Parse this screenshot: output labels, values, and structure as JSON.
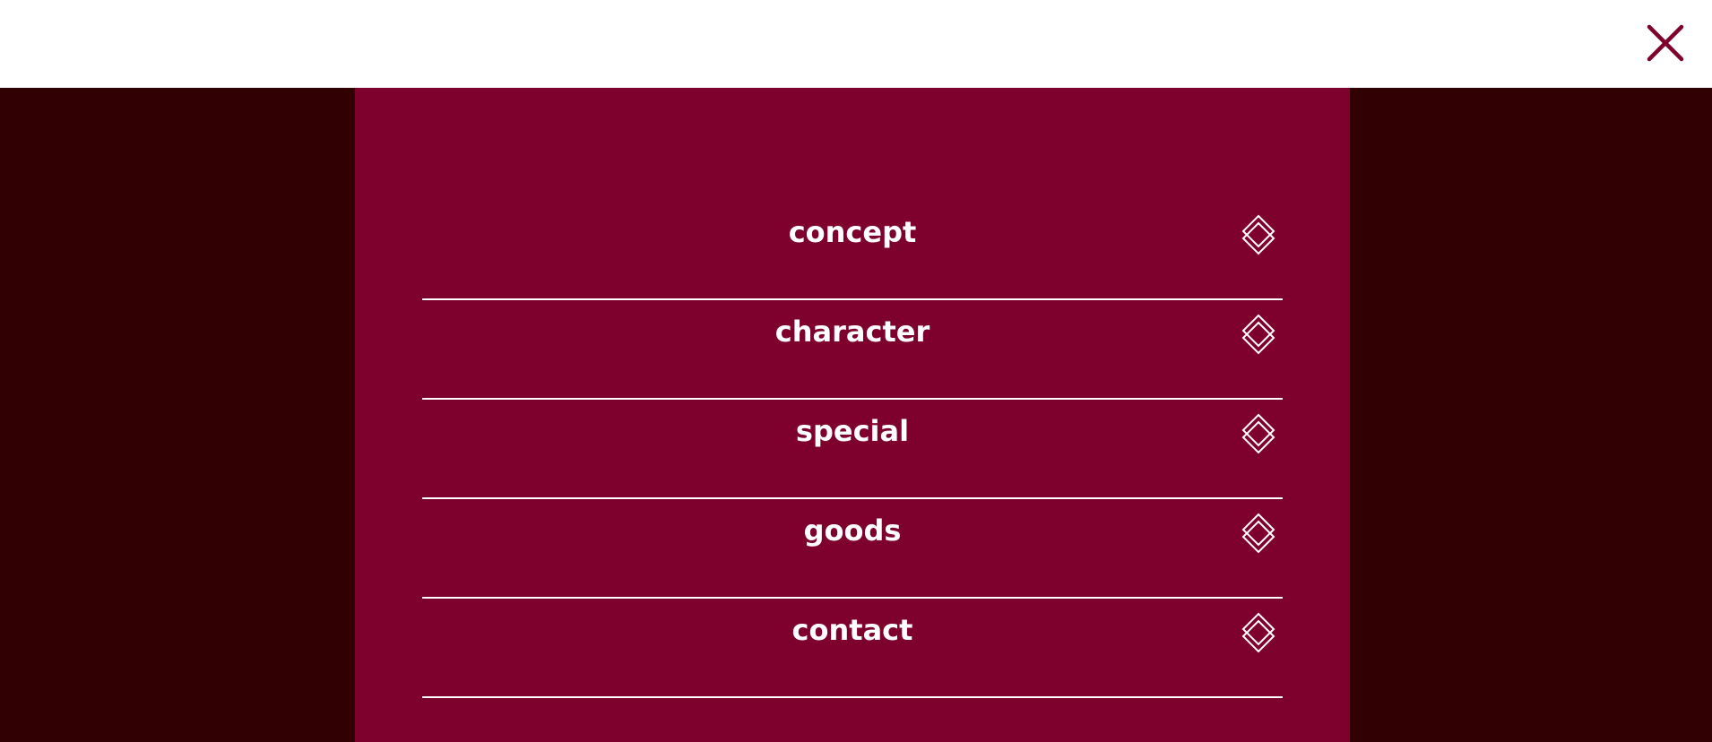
{
  "colors": {
    "header_background": "#ffffff",
    "side_background": "#300003",
    "panel_background": "#7e002c",
    "close_icon_color": "#7e002c",
    "menu_text_color": "#ffffff",
    "divider_color": "#ffffff"
  },
  "header": {
    "close_icon": "close-icon"
  },
  "menu": {
    "items": [
      {
        "label": "concept",
        "icon": "double-diamond-icon"
      },
      {
        "label": "character",
        "icon": "double-diamond-icon"
      },
      {
        "label": "special",
        "icon": "double-diamond-icon"
      },
      {
        "label": "goods",
        "icon": "double-diamond-icon"
      },
      {
        "label": "contact",
        "icon": "double-diamond-icon"
      }
    ]
  }
}
